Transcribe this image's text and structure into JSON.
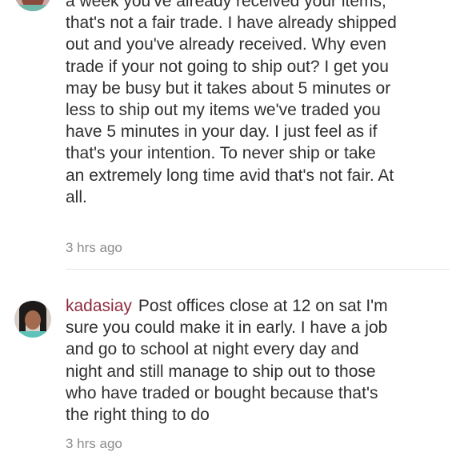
{
  "comments": [
    {
      "lines": [
        "a week you've already received your items,",
        "that's not a fair trade. I have already shipped",
        "out and you've already received. Why even",
        "trade if your not going to ship out? I get you",
        "may be busy but it takes about 5 minutes or",
        "less to ship out my items we've traded you",
        "have 5 minutes in your day. I just feel as if",
        "that's your intention. To never ship or take",
        "an extremely long time avid that's not fair. At",
        "all."
      ],
      "timestamp": "3 hrs ago"
    },
    {
      "username": "kadasiay",
      "first_line": "Post offices close at 12 on sat I'm",
      "lines": [
        "sure you could make it in early. I have a job",
        "and go to school at night every day and",
        "night and still manage to ship out to those",
        "who have traded or bought because that's",
        "the right thing to do"
      ],
      "timestamp": "3 hrs ago"
    }
  ],
  "colors": {
    "username": "#8e2a3f",
    "text": "#2f2f2f",
    "timestamp": "#8b8b8b",
    "divider": "#e3e3e3"
  }
}
